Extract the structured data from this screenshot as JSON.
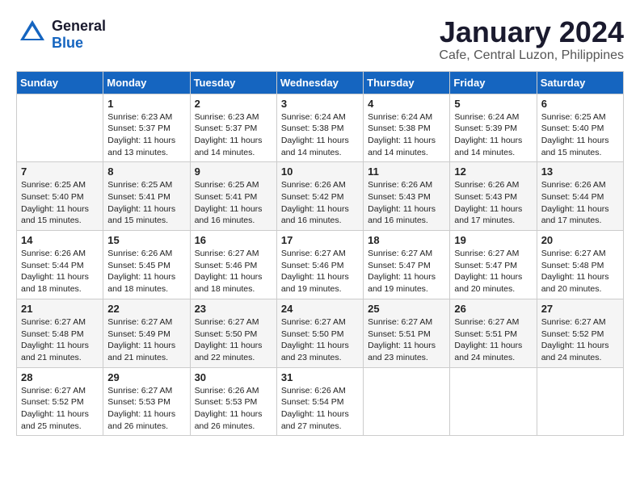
{
  "header": {
    "logo_line1": "General",
    "logo_line2": "Blue",
    "month": "January 2024",
    "location": "Cafe, Central Luzon, Philippines"
  },
  "days_of_week": [
    "Sunday",
    "Monday",
    "Tuesday",
    "Wednesday",
    "Thursday",
    "Friday",
    "Saturday"
  ],
  "weeks": [
    [
      {
        "day": "",
        "sunrise": "",
        "sunset": "",
        "daylight": ""
      },
      {
        "day": "1",
        "sunrise": "Sunrise: 6:23 AM",
        "sunset": "Sunset: 5:37 PM",
        "daylight": "Daylight: 11 hours and 13 minutes."
      },
      {
        "day": "2",
        "sunrise": "Sunrise: 6:23 AM",
        "sunset": "Sunset: 5:37 PM",
        "daylight": "Daylight: 11 hours and 14 minutes."
      },
      {
        "day": "3",
        "sunrise": "Sunrise: 6:24 AM",
        "sunset": "Sunset: 5:38 PM",
        "daylight": "Daylight: 11 hours and 14 minutes."
      },
      {
        "day": "4",
        "sunrise": "Sunrise: 6:24 AM",
        "sunset": "Sunset: 5:38 PM",
        "daylight": "Daylight: 11 hours and 14 minutes."
      },
      {
        "day": "5",
        "sunrise": "Sunrise: 6:24 AM",
        "sunset": "Sunset: 5:39 PM",
        "daylight": "Daylight: 11 hours and 14 minutes."
      },
      {
        "day": "6",
        "sunrise": "Sunrise: 6:25 AM",
        "sunset": "Sunset: 5:40 PM",
        "daylight": "Daylight: 11 hours and 15 minutes."
      }
    ],
    [
      {
        "day": "7",
        "sunrise": "Sunrise: 6:25 AM",
        "sunset": "Sunset: 5:40 PM",
        "daylight": "Daylight: 11 hours and 15 minutes."
      },
      {
        "day": "8",
        "sunrise": "Sunrise: 6:25 AM",
        "sunset": "Sunset: 5:41 PM",
        "daylight": "Daylight: 11 hours and 15 minutes."
      },
      {
        "day": "9",
        "sunrise": "Sunrise: 6:25 AM",
        "sunset": "Sunset: 5:41 PM",
        "daylight": "Daylight: 11 hours and 16 minutes."
      },
      {
        "day": "10",
        "sunrise": "Sunrise: 6:26 AM",
        "sunset": "Sunset: 5:42 PM",
        "daylight": "Daylight: 11 hours and 16 minutes."
      },
      {
        "day": "11",
        "sunrise": "Sunrise: 6:26 AM",
        "sunset": "Sunset: 5:43 PM",
        "daylight": "Daylight: 11 hours and 16 minutes."
      },
      {
        "day": "12",
        "sunrise": "Sunrise: 6:26 AM",
        "sunset": "Sunset: 5:43 PM",
        "daylight": "Daylight: 11 hours and 17 minutes."
      },
      {
        "day": "13",
        "sunrise": "Sunrise: 6:26 AM",
        "sunset": "Sunset: 5:44 PM",
        "daylight": "Daylight: 11 hours and 17 minutes."
      }
    ],
    [
      {
        "day": "14",
        "sunrise": "Sunrise: 6:26 AM",
        "sunset": "Sunset: 5:44 PM",
        "daylight": "Daylight: 11 hours and 18 minutes."
      },
      {
        "day": "15",
        "sunrise": "Sunrise: 6:26 AM",
        "sunset": "Sunset: 5:45 PM",
        "daylight": "Daylight: 11 hours and 18 minutes."
      },
      {
        "day": "16",
        "sunrise": "Sunrise: 6:27 AM",
        "sunset": "Sunset: 5:46 PM",
        "daylight": "Daylight: 11 hours and 18 minutes."
      },
      {
        "day": "17",
        "sunrise": "Sunrise: 6:27 AM",
        "sunset": "Sunset: 5:46 PM",
        "daylight": "Daylight: 11 hours and 19 minutes."
      },
      {
        "day": "18",
        "sunrise": "Sunrise: 6:27 AM",
        "sunset": "Sunset: 5:47 PM",
        "daylight": "Daylight: 11 hours and 19 minutes."
      },
      {
        "day": "19",
        "sunrise": "Sunrise: 6:27 AM",
        "sunset": "Sunset: 5:47 PM",
        "daylight": "Daylight: 11 hours and 20 minutes."
      },
      {
        "day": "20",
        "sunrise": "Sunrise: 6:27 AM",
        "sunset": "Sunset: 5:48 PM",
        "daylight": "Daylight: 11 hours and 20 minutes."
      }
    ],
    [
      {
        "day": "21",
        "sunrise": "Sunrise: 6:27 AM",
        "sunset": "Sunset: 5:48 PM",
        "daylight": "Daylight: 11 hours and 21 minutes."
      },
      {
        "day": "22",
        "sunrise": "Sunrise: 6:27 AM",
        "sunset": "Sunset: 5:49 PM",
        "daylight": "Daylight: 11 hours and 21 minutes."
      },
      {
        "day": "23",
        "sunrise": "Sunrise: 6:27 AM",
        "sunset": "Sunset: 5:50 PM",
        "daylight": "Daylight: 11 hours and 22 minutes."
      },
      {
        "day": "24",
        "sunrise": "Sunrise: 6:27 AM",
        "sunset": "Sunset: 5:50 PM",
        "daylight": "Daylight: 11 hours and 23 minutes."
      },
      {
        "day": "25",
        "sunrise": "Sunrise: 6:27 AM",
        "sunset": "Sunset: 5:51 PM",
        "daylight": "Daylight: 11 hours and 23 minutes."
      },
      {
        "day": "26",
        "sunrise": "Sunrise: 6:27 AM",
        "sunset": "Sunset: 5:51 PM",
        "daylight": "Daylight: 11 hours and 24 minutes."
      },
      {
        "day": "27",
        "sunrise": "Sunrise: 6:27 AM",
        "sunset": "Sunset: 5:52 PM",
        "daylight": "Daylight: 11 hours and 24 minutes."
      }
    ],
    [
      {
        "day": "28",
        "sunrise": "Sunrise: 6:27 AM",
        "sunset": "Sunset: 5:52 PM",
        "daylight": "Daylight: 11 hours and 25 minutes."
      },
      {
        "day": "29",
        "sunrise": "Sunrise: 6:27 AM",
        "sunset": "Sunset: 5:53 PM",
        "daylight": "Daylight: 11 hours and 26 minutes."
      },
      {
        "day": "30",
        "sunrise": "Sunrise: 6:26 AM",
        "sunset": "Sunset: 5:53 PM",
        "daylight": "Daylight: 11 hours and 26 minutes."
      },
      {
        "day": "31",
        "sunrise": "Sunrise: 6:26 AM",
        "sunset": "Sunset: 5:54 PM",
        "daylight": "Daylight: 11 hours and 27 minutes."
      },
      {
        "day": "",
        "sunrise": "",
        "sunset": "",
        "daylight": ""
      },
      {
        "day": "",
        "sunrise": "",
        "sunset": "",
        "daylight": ""
      },
      {
        "day": "",
        "sunrise": "",
        "sunset": "",
        "daylight": ""
      }
    ]
  ]
}
